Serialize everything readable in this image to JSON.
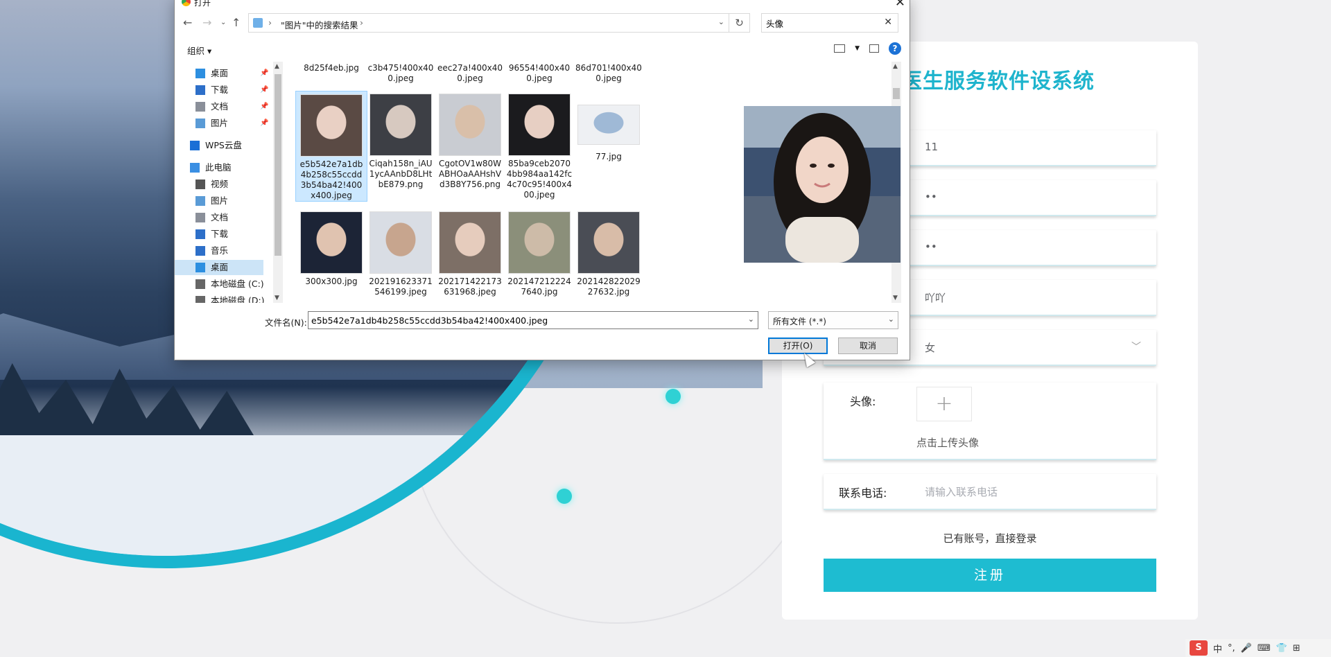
{
  "colors": {
    "accent": "#1ebcd1",
    "title": "#1eb4cd",
    "selection": "#cce8ff",
    "primary_border": "#0078d7"
  },
  "register": {
    "title": "医生服务软件设系统",
    "fields": [
      {
        "value": "11"
      },
      {
        "value": "••"
      },
      {
        "value": "••"
      },
      {
        "value": "吖吖"
      },
      {
        "value": "女"
      }
    ],
    "avatar_label": "头像:",
    "upload_plus": "+",
    "upload_hint": "点击上传头像",
    "phone_label": "联系电话:",
    "phone_placeholder": "请输入联系电话",
    "login_link": "已有账号，直接登录",
    "register_button": "注册"
  },
  "dialog": {
    "title": "打开",
    "close": "✕",
    "breadcrumb": "\"图片\"中的搜索结果",
    "search_value": "头像",
    "organize": "组织 ▾",
    "nav_items": [
      {
        "label": "桌面",
        "icon": "desktop-icon",
        "pinned": true
      },
      {
        "label": "下载",
        "icon": "download-icon",
        "pinned": true
      },
      {
        "label": "文档",
        "icon": "document-icon",
        "pinned": true
      },
      {
        "label": "图片",
        "icon": "pictures-icon",
        "pinned": true
      },
      {
        "label": "WPS云盘",
        "icon": "wps-cloud-icon",
        "pinned": false
      },
      {
        "label": "此电脑",
        "icon": "this-pc-icon",
        "pinned": false
      },
      {
        "label": "视频",
        "icon": "video-icon",
        "pinned": false
      },
      {
        "label": "图片",
        "icon": "pictures-icon",
        "pinned": false
      },
      {
        "label": "文档",
        "icon": "document-icon",
        "pinned": false
      },
      {
        "label": "下载",
        "icon": "download-icon",
        "pinned": false
      },
      {
        "label": "音乐",
        "icon": "music-icon",
        "pinned": false
      },
      {
        "label": "桌面",
        "icon": "desktop-icon",
        "pinned": false,
        "selected": true
      },
      {
        "label": "本地磁盘 (C:)",
        "icon": "drive-icon",
        "pinned": false
      },
      {
        "label": "本地磁盘 (D:)",
        "icon": "drive-icon",
        "pinned": false
      }
    ],
    "files_row0": [
      "8d25f4eb.jpg",
      "c3b475!400x400.jpeg",
      "eec27a!400x400.jpeg",
      "96554!400x400.jpeg",
      "86d701!400x400.jpeg"
    ],
    "files_row1": [
      "e5b542e7a1db4b258c55ccdd3b54ba42!400x400.jpeg",
      "Ciqah158n_iAU1ycAAnbD8LHtbE879.png",
      "CgotOV1w80WABHOaAAHshVd3B8Y756.png",
      "85ba9ceb20704bb984aa142fc4c70c95!400x400.jpeg",
      "77.jpg"
    ],
    "files_row2": [
      "300x300.jpg",
      "202191623371546199.jpeg",
      "202171422173631968.jpeg",
      "2021472122247640.jpg",
      "20214282202927632.jpg"
    ],
    "filename_label": "文件名(N):",
    "filename_value": "e5b542e7a1db4b258c55ccdd3b54ba42!400x400.jpeg",
    "filetype": "所有文件 (*.*)",
    "open_button": "打开(O)",
    "cancel_button": "取消"
  },
  "tray": {
    "logo": "S",
    "ime": "中",
    "punct": "°,"
  }
}
